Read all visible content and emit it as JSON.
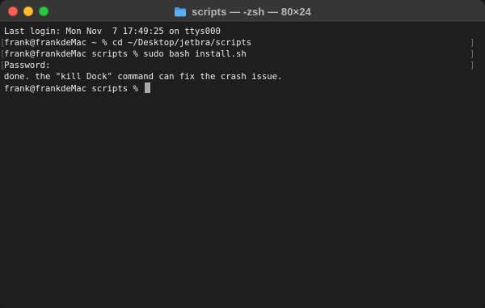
{
  "window": {
    "title": "scripts — -zsh — 80×24",
    "folder_icon": "folder-icon",
    "traffic_lights": [
      "close",
      "minimize",
      "zoom"
    ]
  },
  "terminal": {
    "lines": [
      "Last login: Mon Nov  7 17:49:25 on ttys000",
      "frank@frankdeMac ~ % cd ~/Desktop/jetbra/scripts",
      "frank@frankdeMac scripts % sudo bash install.sh",
      "Password:",
      "done. the \"kill Dock\" command can fix the crash issue.",
      "frank@frankdeMac scripts % "
    ],
    "marked_lines": [
      1,
      2,
      3
    ]
  },
  "colors": {
    "background": "#1e1e1e",
    "titlebar": "#363636",
    "text": "#eaeaea",
    "folder": "#5ab0f0"
  }
}
